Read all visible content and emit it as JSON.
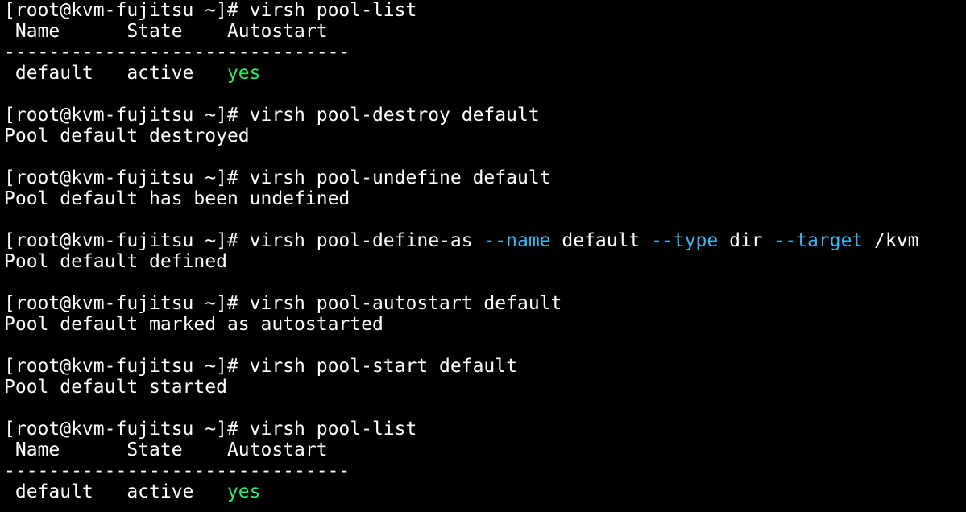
{
  "terminal": {
    "background": "#000000",
    "text_color": "#ffffff",
    "flag_color": "#38b6f0",
    "yes_color": "#2ee96a",
    "lines": [
      {
        "segments": [
          {
            "text": "[root@kvm-fujitsu ~]# virsh pool-list",
            "role": "text"
          }
        ]
      },
      {
        "segments": [
          {
            "text": " Name      State    Autostart",
            "role": "text"
          }
        ]
      },
      {
        "segments": [
          {
            "text": "-------------------------------",
            "role": "text"
          }
        ]
      },
      {
        "segments": [
          {
            "text": " default   active   ",
            "role": "text"
          },
          {
            "text": "yes",
            "role": "yes"
          }
        ]
      },
      {
        "segments": [
          {
            "text": "",
            "role": "text"
          }
        ]
      },
      {
        "segments": [
          {
            "text": "[root@kvm-fujitsu ~]# virsh pool-destroy default",
            "role": "text"
          }
        ]
      },
      {
        "segments": [
          {
            "text": "Pool default destroyed",
            "role": "text"
          }
        ]
      },
      {
        "segments": [
          {
            "text": "",
            "role": "text"
          }
        ]
      },
      {
        "segments": [
          {
            "text": "[root@kvm-fujitsu ~]# virsh pool-undefine default",
            "role": "text"
          }
        ]
      },
      {
        "segments": [
          {
            "text": "Pool default has been undefined",
            "role": "text"
          }
        ]
      },
      {
        "segments": [
          {
            "text": "",
            "role": "text"
          }
        ]
      },
      {
        "segments": [
          {
            "text": "[root@kvm-fujitsu ~]# virsh pool-define-as ",
            "role": "text"
          },
          {
            "text": "--name",
            "role": "flag"
          },
          {
            "text": " default ",
            "role": "text"
          },
          {
            "text": "--type",
            "role": "flag"
          },
          {
            "text": " dir ",
            "role": "text"
          },
          {
            "text": "--target",
            "role": "flag"
          },
          {
            "text": " /kvm",
            "role": "text"
          }
        ]
      },
      {
        "segments": [
          {
            "text": "Pool default defined",
            "role": "text"
          }
        ]
      },
      {
        "segments": [
          {
            "text": "",
            "role": "text"
          }
        ]
      },
      {
        "segments": [
          {
            "text": "[root@kvm-fujitsu ~]# virsh pool-autostart default",
            "role": "text"
          }
        ]
      },
      {
        "segments": [
          {
            "text": "Pool default marked as autostarted",
            "role": "text"
          }
        ]
      },
      {
        "segments": [
          {
            "text": "",
            "role": "text"
          }
        ]
      },
      {
        "segments": [
          {
            "text": "[root@kvm-fujitsu ~]# virsh pool-start default",
            "role": "text"
          }
        ]
      },
      {
        "segments": [
          {
            "text": "Pool default started",
            "role": "text"
          }
        ]
      },
      {
        "segments": [
          {
            "text": "",
            "role": "text"
          }
        ]
      },
      {
        "segments": [
          {
            "text": "[root@kvm-fujitsu ~]# virsh pool-list",
            "role": "text"
          }
        ]
      },
      {
        "segments": [
          {
            "text": " Name      State    Autostart",
            "role": "text"
          }
        ]
      },
      {
        "segments": [
          {
            "text": "-------------------------------",
            "role": "text"
          }
        ]
      },
      {
        "segments": [
          {
            "text": " default   active   ",
            "role": "text"
          },
          {
            "text": "yes",
            "role": "yes"
          }
        ]
      }
    ]
  }
}
